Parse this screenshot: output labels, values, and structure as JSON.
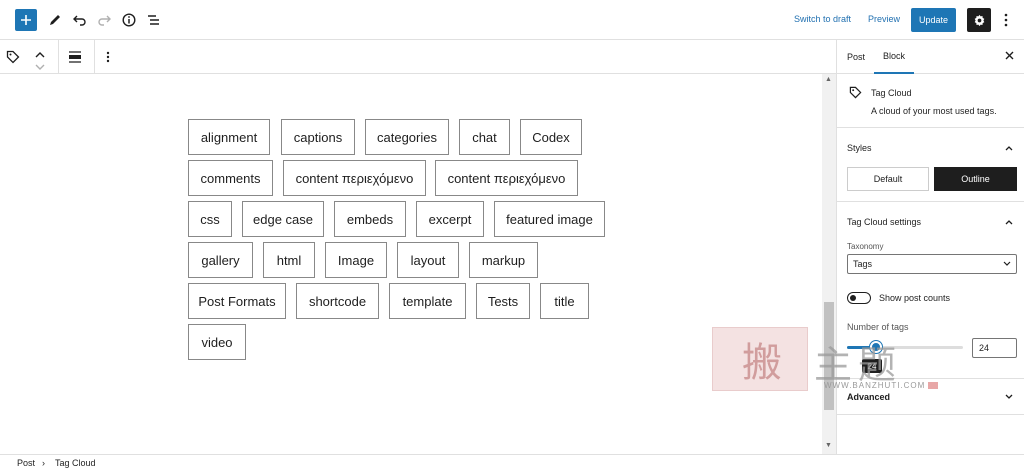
{
  "header": {
    "switch_to_draft": "Switch to draft",
    "preview": "Preview",
    "update": "Update",
    "icons": [
      "plus-icon",
      "pencil-icon",
      "undo-icon",
      "redo-icon",
      "info-icon",
      "list-view-icon",
      "gear-icon",
      "more-vertical-icon"
    ]
  },
  "block_toolbar": {
    "icons": [
      "tag-icon",
      "move-up-icon",
      "move-down-icon",
      "align-icon",
      "more-vertical-icon"
    ]
  },
  "tags": [
    "alignment",
    "captions",
    "categories",
    "chat",
    "Codex",
    "comments",
    "content περιεχόμενο",
    "content περιεχόμενο",
    "css",
    "edge case",
    "embeds",
    "excerpt",
    "featured image",
    "gallery",
    "html",
    "Image",
    "layout",
    "markup",
    "Post Formats",
    "shortcode",
    "template",
    "Tests",
    "title",
    "video"
  ],
  "sidebar": {
    "tabs": [
      "Post",
      "Block"
    ],
    "active_tab": "Block",
    "block_title": "Tag Cloud",
    "block_desc": "A cloud of your most used tags.",
    "styles_heading": "Styles",
    "style_default": "Default",
    "style_outline": "Outline",
    "settings_heading": "Tag Cloud settings",
    "taxonomy_label": "Taxonomy",
    "taxonomy_value": "Tags",
    "show_counts_label": "Show post counts",
    "show_counts_on": false,
    "number_label": "Number of tags",
    "number_value": "24",
    "slider_fraction": 0.25,
    "advanced_heading": "Advanced"
  },
  "watermark": {
    "stamp": "搬",
    "text": "主题",
    "url": "WWW.BANZHUTI.COM"
  },
  "breadcrumb": {
    "items": [
      "Post",
      "Tag Cloud"
    ],
    "separator": "›"
  },
  "colors": {
    "accent": "#1e76b5",
    "dark": "#1e1e1e"
  }
}
